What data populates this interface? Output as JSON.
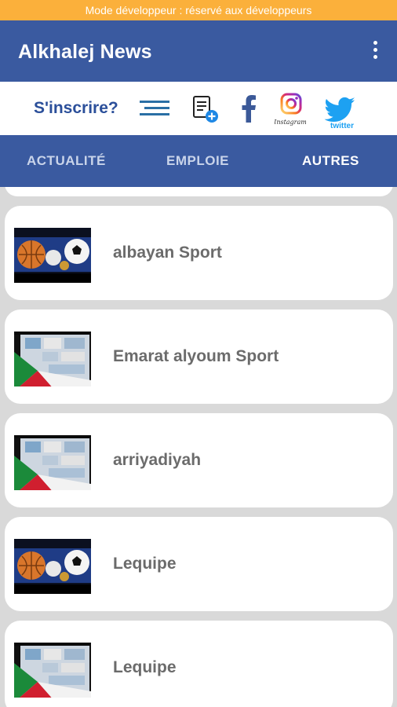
{
  "status_banner": "Mode développeur : réservé aux développeurs",
  "app_bar": {
    "title": "Alkhalej News"
  },
  "social_bar": {
    "signup_label": "S'inscrire?",
    "instagram_caption": "Instagram",
    "twitter_caption": "twitter"
  },
  "tabs": [
    {
      "label": "ACTUALITÉ",
      "active": false
    },
    {
      "label": "EMPLOIE",
      "active": false
    },
    {
      "label": "AUTRES",
      "active": true
    }
  ],
  "items": [
    {
      "label": "albayan Sport",
      "thumbnail": "sports-balls-image"
    },
    {
      "label": "Emarat alyoum Sport",
      "thumbnail": "newspapers-collage-image"
    },
    {
      "label": "arriyadiyah",
      "thumbnail": "newspapers-collage-image"
    },
    {
      "label": "Lequipe",
      "thumbnail": "sports-balls-image"
    },
    {
      "label": "Lequipe",
      "thumbnail": "newspapers-collage-image"
    }
  ],
  "colors": {
    "banner": "#fbb03b",
    "primary": "#3a5aa0",
    "signup_text": "#2b4f9a",
    "facebook": "#3b5998",
    "twitter": "#1da1f2"
  }
}
